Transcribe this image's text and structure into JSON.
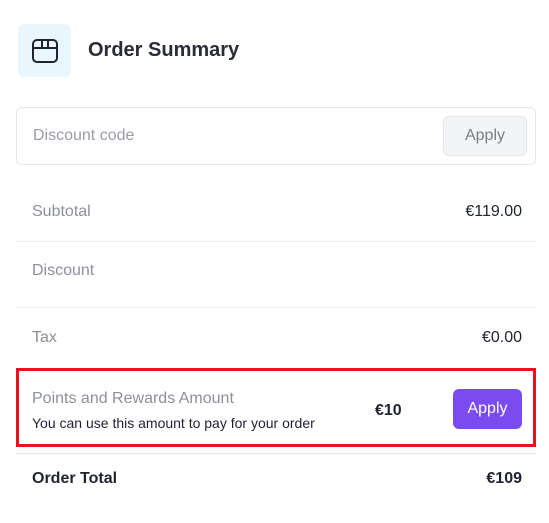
{
  "header": {
    "title": "Order Summary",
    "icon": "package-icon"
  },
  "discount": {
    "placeholder": "Discount code",
    "value": "",
    "apply_label": "Apply"
  },
  "summary": {
    "subtotal_label": "Subtotal",
    "subtotal_value": "€119.00",
    "discount_label": "Discount",
    "discount_value": "",
    "tax_label": "Tax",
    "tax_value": "€0.00"
  },
  "points": {
    "label": "Points and Rewards Amount",
    "hint": "You can use this amount to pay for your order",
    "amount": "€10",
    "apply_label": "Apply",
    "highlight_color": "#e8141b",
    "button_color": "#7a4cf0"
  },
  "total": {
    "label": "Order Total",
    "value": "€109"
  }
}
